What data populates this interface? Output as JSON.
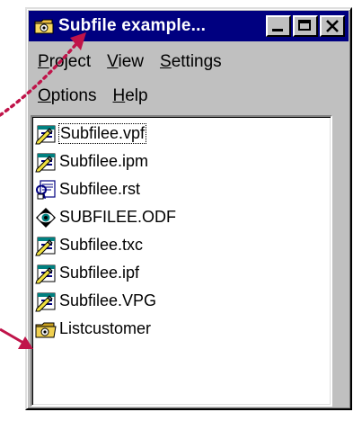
{
  "window": {
    "title": "Subfile example...",
    "title_icon": "project-folder-icon",
    "buttons": {
      "minimize": "minimize-icon",
      "maximize": "maximize-icon",
      "close": "close-icon"
    }
  },
  "menubar": {
    "row1": [
      {
        "accel": "P",
        "rest": "roject"
      },
      {
        "accel": "V",
        "rest": "iew"
      },
      {
        "accel": "S",
        "rest": "ettings"
      }
    ],
    "row2": [
      {
        "accel": "O",
        "rest": "ptions"
      },
      {
        "accel": "H",
        "rest": "elp"
      }
    ]
  },
  "list": {
    "items": [
      {
        "label": "Subfilee.vpf",
        "icon": "pen-form-icon",
        "selected": true
      },
      {
        "label": "Subfilee.ipm",
        "icon": "pen-form-icon",
        "selected": false
      },
      {
        "label": "Subfilee.rst",
        "icon": "report-icon",
        "selected": false
      },
      {
        "label": "SUBFILEE.ODF",
        "icon": "eye-data-icon",
        "selected": false
      },
      {
        "label": "Subfilee.txc",
        "icon": "pen-form-icon",
        "selected": false
      },
      {
        "label": "Subfilee.ipf",
        "icon": "pen-form-icon",
        "selected": false
      },
      {
        "label": "Subfilee.VPG",
        "icon": "pen-form-icon",
        "selected": false
      },
      {
        "label": "Listcustomer",
        "icon": "project-folder-icon",
        "selected": false
      }
    ]
  },
  "colors": {
    "titlebar": "#000080",
    "face": "#c0c0c0",
    "annotation_arrow": "#c0144a"
  }
}
